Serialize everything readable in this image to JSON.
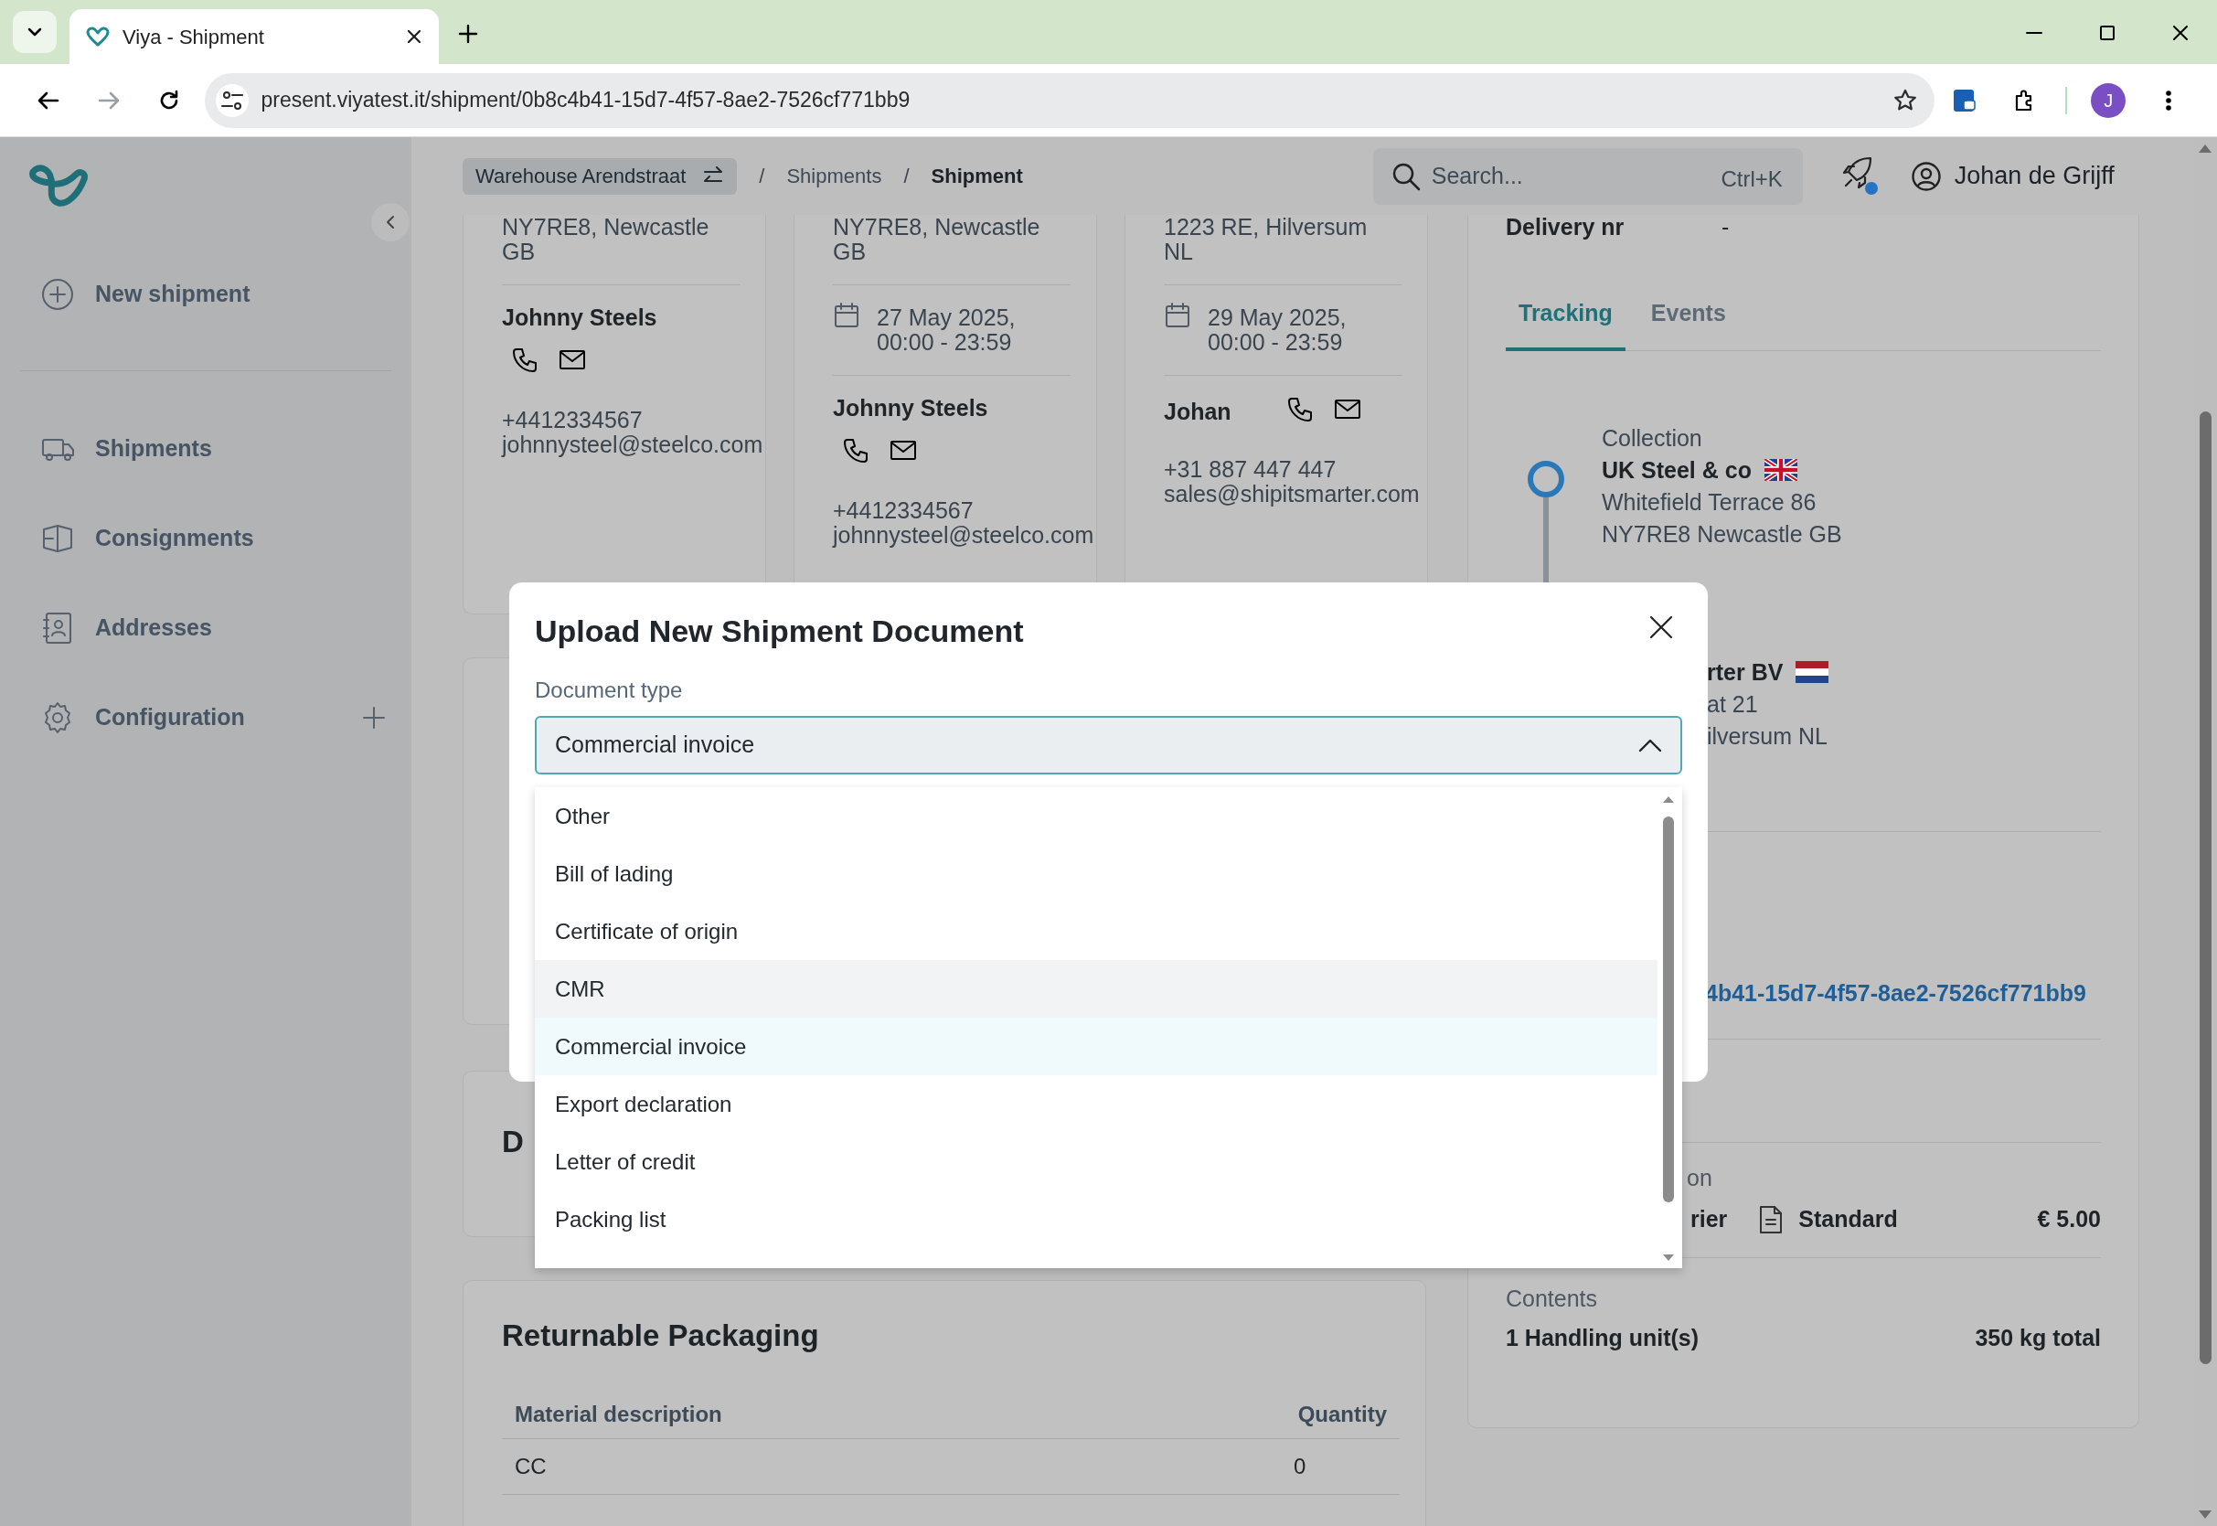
{
  "browser": {
    "tab_title": "Viya - Shipment",
    "url": "present.viyatest.it/shipment/0b8c4b41-15d7-4f57-8ae2-7526cf771bb9",
    "profile_initial": "J"
  },
  "sidebar": {
    "items": [
      {
        "label": "New shipment",
        "has_add": false
      },
      {
        "label": "Shipments",
        "has_add": false
      },
      {
        "label": "Consignments",
        "has_add": false
      },
      {
        "label": "Addresses",
        "has_add": false
      },
      {
        "label": "Configuration",
        "has_add": true
      }
    ]
  },
  "header": {
    "location": "Warehouse Arendstraat",
    "separator": "/",
    "breadcrumbs": [
      {
        "label": "Shipments",
        "current": false
      },
      {
        "label": "Shipment",
        "current": true
      }
    ],
    "search": {
      "placeholder": "Search...",
      "shortcut": "Ctrl+K"
    },
    "notification": true,
    "user": "Johan de Grijff"
  },
  "stop_cards": [
    {
      "address_lines": [
        "NY7RE8, Newcastle",
        "GB"
      ],
      "contact": {
        "name": "Johnny Steels",
        "phone": "+4412334567",
        "email": "johnnysteel@steelco.com",
        "kind": "stacked"
      }
    },
    {
      "address_lines": [
        "NY7RE8, Newcastle",
        "GB"
      ],
      "date_lines": [
        "27 May 2025,",
        "00:00 - 23:59"
      ],
      "contact": {
        "name": "Johnny Steels",
        "phone": "+4412334567",
        "email": "johnnysteel@steelco.com",
        "kind": "stacked"
      }
    },
    {
      "address_lines": [
        "1223 RE, Hilversum",
        "NL"
      ],
      "date_lines": [
        "29 May 2025,",
        "00:00 - 23:59"
      ],
      "contact": {
        "name": "Johan",
        "phone": "+31 887 447 447",
        "email": "sales@shipitsmarter.com",
        "kind": "inline"
      }
    }
  ],
  "detail_panel": {
    "delivery": {
      "label": "Delivery nr",
      "value": "-"
    },
    "tabs": [
      {
        "label": "Tracking",
        "selected": true
      },
      {
        "label": "Events",
        "selected": false
      }
    ],
    "stops": [
      {
        "type": "Collection",
        "name": "UK Steel & co",
        "kind": "gb",
        "lines": [
          "Whitefield Terrace 86",
          "NY7RE8 Newcastle GB"
        ],
        "marker": true
      },
      {
        "name": "rter BV",
        "kind": "nl",
        "lines": [
          "at 21",
          "ilversum NL"
        ],
        "marker": false
      }
    ],
    "reference": {
      "link": "4b41-15d7-4f57-8ae2-7526cf771bb9"
    },
    "service": {
      "label": "on",
      "carrier": "rier",
      "service_level": "Standard",
      "price": "€ 5.00"
    },
    "contents": {
      "label": "Contents",
      "units": "1 Handling unit(s)",
      "weight": "350 kg total"
    }
  },
  "documents_card": {
    "title": "D"
  },
  "returnable": {
    "title": "Returnable Packaging",
    "columns": [
      "Material description",
      "Quantity"
    ],
    "rows": [
      [
        "CC",
        "0"
      ]
    ]
  },
  "modal": {
    "title": "Upload New Shipment Document",
    "field_label": "Document type",
    "value": "Commercial invoice",
    "expanded": true,
    "options": [
      {
        "label": "Other",
        "selected": false,
        "hovered": false
      },
      {
        "label": "Bill of lading",
        "selected": false,
        "hovered": false
      },
      {
        "label": "Certificate of origin",
        "selected": false,
        "hovered": false
      },
      {
        "label": "CMR",
        "selected": false,
        "hovered": true
      },
      {
        "label": "Commercial invoice",
        "selected": true,
        "hovered": false
      },
      {
        "label": "Export declaration",
        "selected": false,
        "hovered": false
      },
      {
        "label": "Letter of credit",
        "selected": false,
        "hovered": false
      },
      {
        "label": "Packing list",
        "selected": false,
        "hovered": false
      }
    ]
  }
}
